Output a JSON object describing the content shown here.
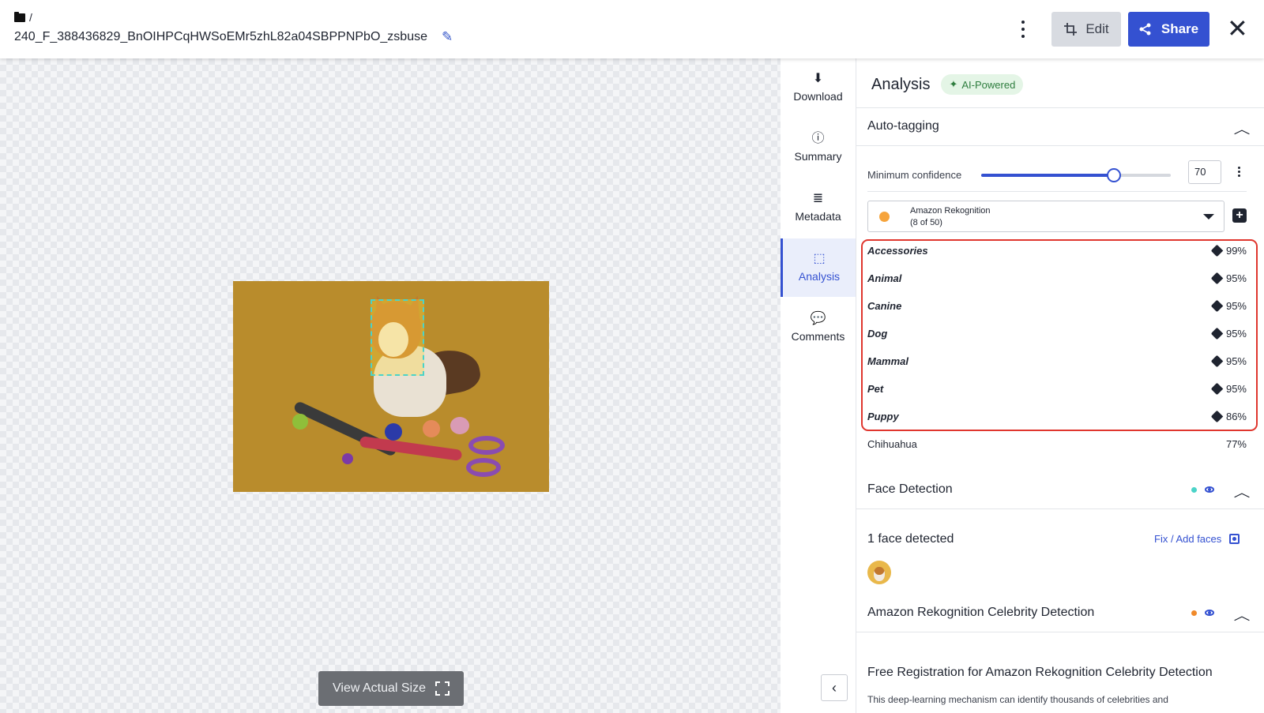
{
  "header": {
    "breadcrumb_sep": "/",
    "filename": "240_F_388436829_BnOIHPCqHWSoEMr5zhL82a04SBPPNPbO_zsbuse",
    "edit_label": "Edit",
    "share_label": "Share"
  },
  "canvas": {
    "view_actual_label": "View Actual Size"
  },
  "rail": {
    "items": [
      {
        "label": "Download",
        "icon": "download-icon"
      },
      {
        "label": "Summary",
        "icon": "info-icon"
      },
      {
        "label": "Metadata",
        "icon": "list-icon"
      },
      {
        "label": "Analysis",
        "icon": "analysis-icon",
        "active": true
      },
      {
        "label": "Comments",
        "icon": "comments-icon"
      }
    ]
  },
  "panel": {
    "title": "Analysis",
    "ai_badge": "AI-Powered",
    "autotag": {
      "title": "Auto-tagging",
      "confidence_label": "Minimum confidence",
      "confidence_value": "70",
      "confidence_fraction": 0.7,
      "provider_name": "Amazon Rekognition",
      "provider_count": "(8 of 50)",
      "provider_color": "#f6a43c",
      "tags": [
        {
          "name": "Accessories",
          "value": "99%"
        },
        {
          "name": "Animal",
          "value": "95%"
        },
        {
          "name": "Canine",
          "value": "95%"
        },
        {
          "name": "Dog",
          "value": "95%"
        },
        {
          "name": "Mammal",
          "value": "95%"
        },
        {
          "name": "Pet",
          "value": "95%"
        },
        {
          "name": "Puppy",
          "value": "86%"
        }
      ],
      "extra_tag": {
        "name": "Chihuahua",
        "value": "77%"
      }
    },
    "face_detection": {
      "title": "Face Detection",
      "dot_color": "#4bd3c8",
      "count_text": "1 face detected",
      "fix_link": "Fix / Add faces"
    },
    "celebrity": {
      "title": "Amazon Rekognition Celebrity Detection",
      "dot_color": "#f08a2b",
      "reg_title": "Free Registration for Amazon Rekognition Celebrity Detection",
      "reg_desc": "This deep-learning mechanism can identify thousands of celebrities and"
    }
  },
  "colors": {
    "accent": "#3451d1",
    "highlight_border": "#e0362e"
  }
}
